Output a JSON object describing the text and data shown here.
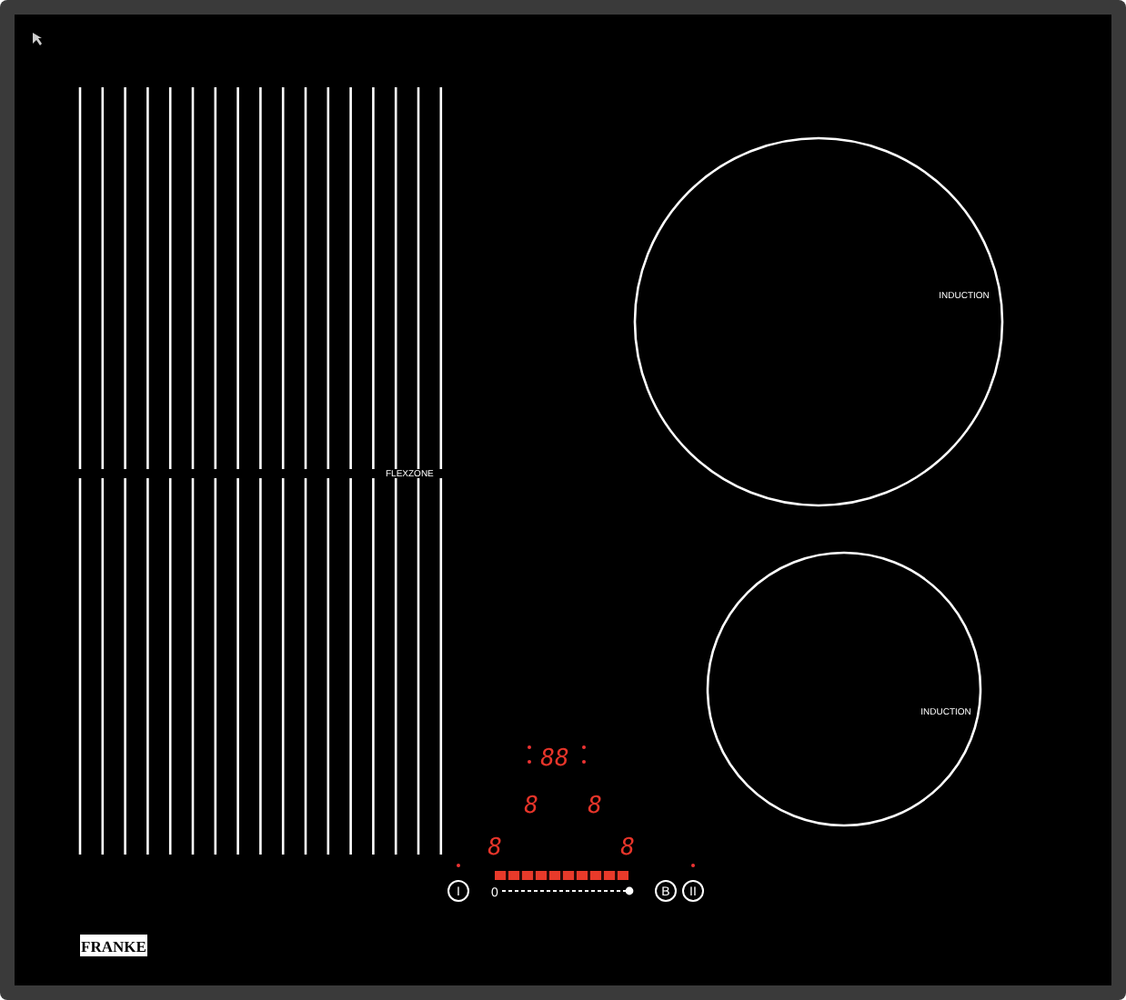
{
  "zones": [
    {
      "kind": "flex",
      "label": "FLEXZONE"
    },
    {
      "kind": "round",
      "label": "INDUCTION"
    },
    {
      "kind": "round",
      "label": "INDUCTION"
    }
  ],
  "display": {
    "timer": "88",
    "zone_digits": [
      "8",
      "8",
      "8",
      "8"
    ]
  },
  "power_bar": {
    "level": 1
  },
  "slider": {
    "start_label": "0",
    "level": 1
  },
  "buttons": [
    {
      "label": "I"
    },
    {
      "label": "B"
    },
    {
      "label": "II"
    }
  ],
  "brand": "FRANKE"
}
